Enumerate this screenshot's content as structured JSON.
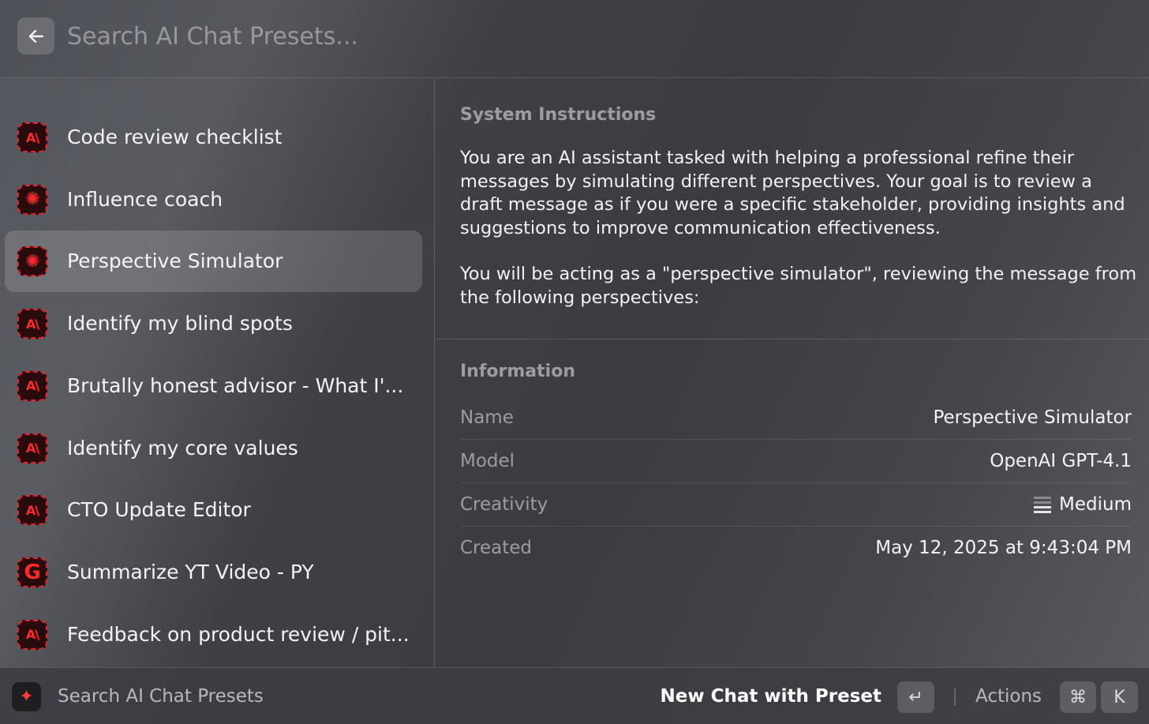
{
  "search": {
    "placeholder": "Search AI Chat Presets..."
  },
  "presets": [
    {
      "label": "Code review checklist",
      "icon": "anthropic-icon",
      "glyph": "A\\",
      "selected": false
    },
    {
      "label": "Influence coach",
      "icon": "openai-icon",
      "glyph": "✺",
      "selected": false
    },
    {
      "label": "Perspective Simulator",
      "icon": "openai-icon",
      "glyph": "✺",
      "selected": true
    },
    {
      "label": "Identify my blind spots",
      "icon": "anthropic-icon",
      "glyph": "A\\",
      "selected": false
    },
    {
      "label": "Brutally honest advisor - What I'...",
      "icon": "anthropic-icon",
      "glyph": "A\\",
      "selected": false
    },
    {
      "label": "Identify my core values",
      "icon": "anthropic-icon",
      "glyph": "A\\",
      "selected": false
    },
    {
      "label": "CTO Update Editor",
      "icon": "anthropic-icon",
      "glyph": "A\\",
      "selected": false
    },
    {
      "label": "Summarize YT Video - PY",
      "icon": "google-icon",
      "glyph": "G",
      "selected": false
    },
    {
      "label": "Feedback on product review / pit...",
      "icon": "anthropic-icon",
      "glyph": "A\\",
      "selected": false
    }
  ],
  "detail": {
    "instructions_title": "System Instructions",
    "instructions_paragraphs": [
      "You are an AI assistant tasked with helping a professional refine their messages by simulating different perspectives. Your goal is to review a draft message as if you were a specific stakeholder, providing insights and suggestions to improve communication effectiveness.",
      "You will be acting as a \"perspective simulator\", reviewing the message from the following perspectives:"
    ],
    "info_title": "Information",
    "info": {
      "name_key": "Name",
      "name_val": "Perspective Simulator",
      "model_key": "Model",
      "model_val": "OpenAI GPT-4.1",
      "creativity_key": "Creativity",
      "creativity_val": "Medium",
      "creativity_level": 2,
      "creativity_max": 4,
      "created_key": "Created",
      "created_val": "May 12, 2025 at 9:43:04 PM"
    }
  },
  "footer": {
    "title": "Search AI Chat Presets",
    "primary_action": "New Chat with Preset",
    "enter_key": "↵",
    "actions_label": "Actions",
    "cmd_key": "⌘",
    "k_key": "K"
  },
  "colors": {
    "accent_red": "#e0262c",
    "selected_bg": "rgba(255,255,255,0.15)"
  }
}
